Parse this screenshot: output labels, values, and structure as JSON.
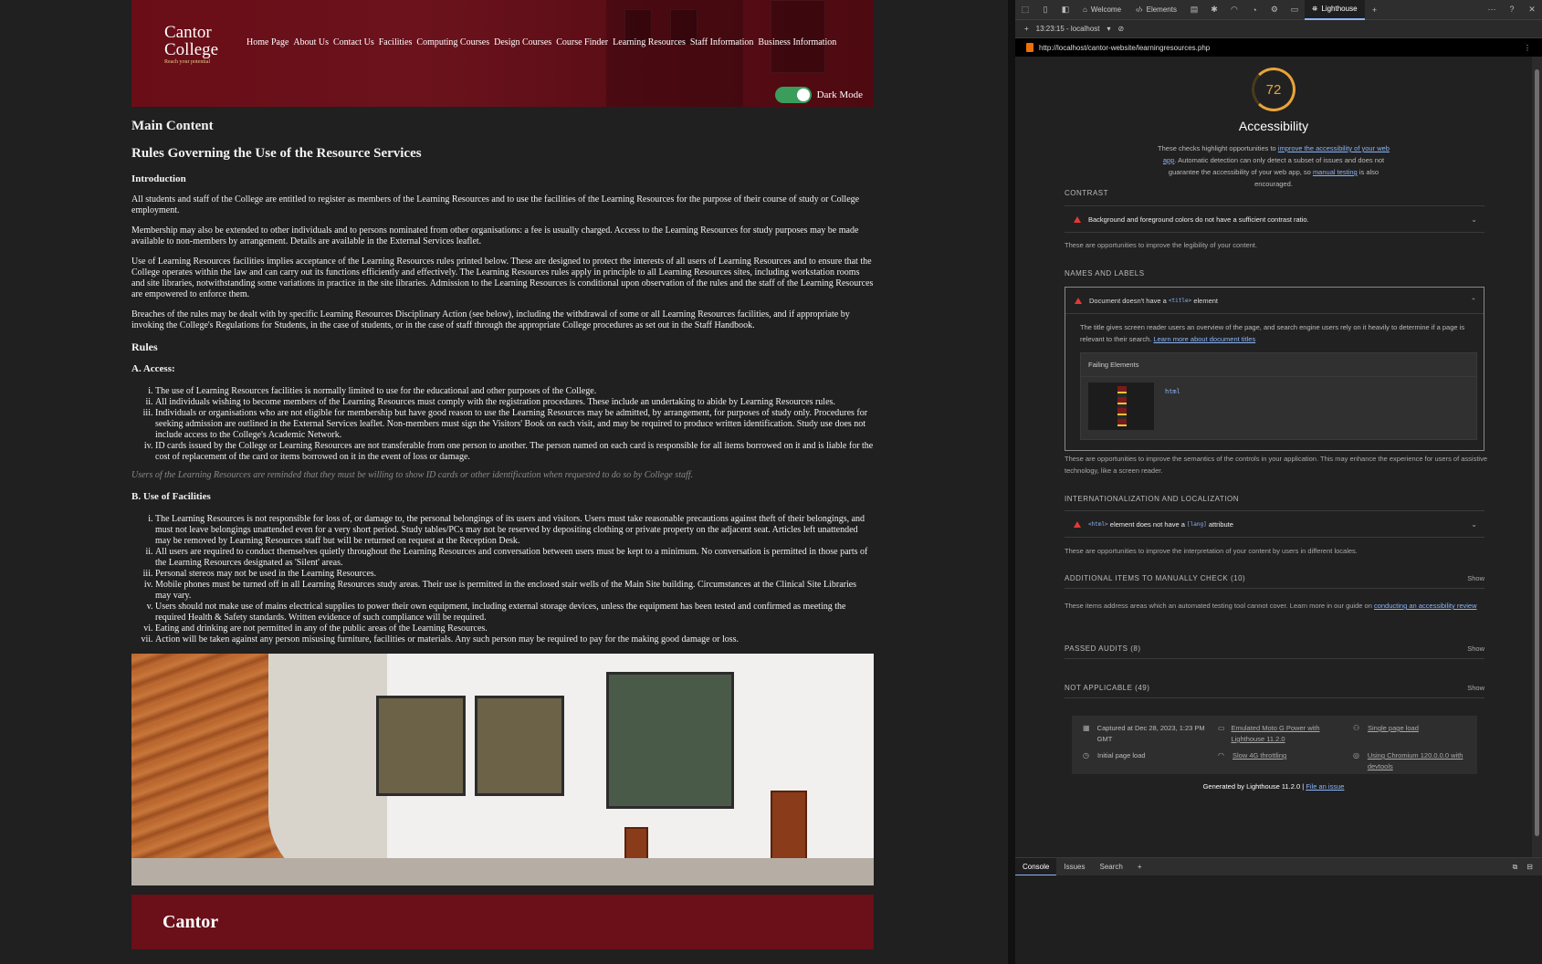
{
  "site": {
    "logo": {
      "line1": "Cantor",
      "line2": "College",
      "tagline": "Reach your potential"
    },
    "nav": [
      "Home Page",
      "About Us",
      "Contact Us",
      "Facilities",
      "Computing Courses",
      "Design Courses",
      "Course Finder",
      "Learning Resources",
      "Staff Information",
      "Business Information"
    ],
    "dark_mode_label": "Dark Mode",
    "main_heading": "Main Content",
    "page_heading": "Rules Governing the Use of the Resource Services",
    "intro_heading": "Introduction",
    "intro_paragraphs": [
      "All students and staff of the College are entitled to register as members of the Learning Resources and to use the facilities of the Learning Resources for the purpose of their course of study or College employment.",
      "Membership may also be extended to other individuals and to persons nominated from other organisations: a fee is usually charged. Access to the Learning Resources for study purposes may be made available to non-members by arrangement. Details are available in the External Services leaflet.",
      "Use of Learning Resources facilities implies acceptance of the Learning Resources rules printed below. These are designed to protect the interests of all users of Learning Resources and to ensure that the College operates within the law and can carry out its functions efficiently and effectively. The Learning Resources rules apply in principle to all Learning Resources sites, including workstation rooms and site libraries, notwithstanding some variations in practice in the site libraries. Admission to the Learning Resources is conditional upon observation of the rules and the staff of the Learning Resources are empowered to enforce them.",
      "Breaches of the rules may be dealt with by specific Learning Resources Disciplinary Action (see below), including the withdrawal of some or all Learning Resources facilities, and if appropriate by invoking the College's Regulations for Students, in the case of students, or in the case of staff through the appropriate College procedures as set out in the Staff Handbook."
    ],
    "rules_heading": "Rules",
    "access_heading": "A. Access:",
    "access_items": [
      "The use of Learning Resources facilities is normally limited to use for the educational and other purposes of the College.",
      "All individuals wishing to become members of the Learning Resources must comply with the registration procedures. These include an undertaking to abide by Learning Resources rules.",
      "Individuals or organisations who are not eligible for membership but have good reason to use the Learning Resources may be admitted, by arrangement, for purposes of study only. Procedures for seeking admission are outlined in the External Services leaflet. Non-members must sign the Visitors' Book on each visit, and may be required to produce written identification. Study use does not include access to the College's Academic Network.",
      "ID cards issued by the College or Learning Resources are not transferable from one person to another. The person named on each card is responsible for all items borrowed on it and is liable for the cost of replacement of the card or items borrowed on it in the event of loss or damage."
    ],
    "access_note": "Users of the Learning Resources are reminded that they must be willing to show ID cards or other identification when requested to do so by College staff.",
    "facilities_heading": "B. Use of Facilities",
    "facilities_items": [
      "The Learning Resources is not responsible for loss of, or damage to, the personal belongings of its users and visitors. Users must take reasonable precautions against theft of their belongings, and must not leave belongings unattended even for a very short period. Study tables/PCs may not be reserved by depositing clothing or private property on the adjacent seat. Articles left unattended may be removed by Learning Resources staff but will be returned on request at the Reception Desk.",
      "All users are required to conduct themselves quietly throughout the Learning Resources and conversation between users must be kept to a minimum. No conversation is permitted in those parts of the Learning Resources designated as 'Silent' areas.",
      "Personal stereos may not be used in the Learning Resources.",
      "Mobile phones must be turned off in all Learning Resources study areas. Their use is permitted in the enclosed stair wells of the Main Site building. Circumstances at the Clinical Site Libraries may vary.",
      "Users should not make use of mains electrical supplies to power their own equipment, including external storage devices, unless the equipment has been tested and confirmed as meeting the required Health & Safety standards. Written evidence of such compliance will be required.",
      "Eating and drinking are not permitted in any of the public areas of the Learning Resources.",
      "Action will be taken against any person misusing furniture, facilities or materials. Any such person may be required to pay for the making good damage or loss."
    ],
    "footer_title": "Cantor"
  },
  "devtools": {
    "tabs": [
      "Welcome",
      "Elements",
      "Lighthouse"
    ],
    "report_time": "13:23:15 - localhost",
    "url": "http://localhost/cantor-website/learningresources.php",
    "drawer_tabs": [
      "Console",
      "Issues",
      "Search"
    ]
  },
  "lighthouse": {
    "score": "72",
    "score_color": "#e8a43a",
    "category": "Accessibility",
    "desc_pre": "These checks highlight opportunities to",
    "desc_link1": "improve the accessibility of your web app",
    "desc_mid": ". Automatic detection can only detect a subset of issues and does not guarantee the accessibility of your web app, so",
    "desc_link2": "manual testing",
    "desc_post": "is also encouraged.",
    "contrast_heading": "CONTRAST",
    "contrast_audit": "Background and foreground colors do not have a sufficient contrast ratio.",
    "contrast_sub": "These are opportunities to improve the legibility of your content.",
    "names_heading": "NAMES AND LABELS",
    "title_audit_pre": "Document doesn't have a",
    "title_audit_code": "<title>",
    "title_audit_post": "element",
    "title_audit_desc": "The title gives screen reader users an overview of the page, and search engine users rely on it heavily to determine if a page is relevant to their search.",
    "title_audit_link": "Learn more about document titles",
    "failing_label": "Failing Elements",
    "failing_node": "html",
    "names_sub": "These are opportunities to improve the semantics of the controls in your application. This may enhance the experience for users of assistive technology, like a screen reader.",
    "i18n_heading": "INTERNATIONALIZATION AND LOCALIZATION",
    "lang_code1": "<html>",
    "lang_mid": "element does not have a",
    "lang_code2": "[lang]",
    "lang_post": "attribute",
    "i18n_sub": "These are opportunities to improve the interpretation of your content by users in different locales.",
    "manual_heading": "ADDITIONAL ITEMS TO MANUALLY CHECK (10)",
    "manual_sub_pre": "These items address areas which an automated testing tool cannot cover. Learn more in our guide on",
    "manual_sub_link": "conducting an accessibility review",
    "passed_heading": "PASSED AUDITS (8)",
    "na_heading": "NOT APPLICABLE (49)",
    "show_label": "Show",
    "env": {
      "captured": "Captured at Dec 28, 2023, 1:23 PM GMT",
      "initial": "Initial page load",
      "device": "Emulated Moto G Power with Lighthouse 11.2.0",
      "throttle": "Slow 4G throttling",
      "mode": "Single page load",
      "browser": "Using Chromium 120.0.0.0 with devtools"
    },
    "generated_pre": "Generated by Lighthouse 11.2.0 |",
    "generated_link": "File an issue"
  }
}
